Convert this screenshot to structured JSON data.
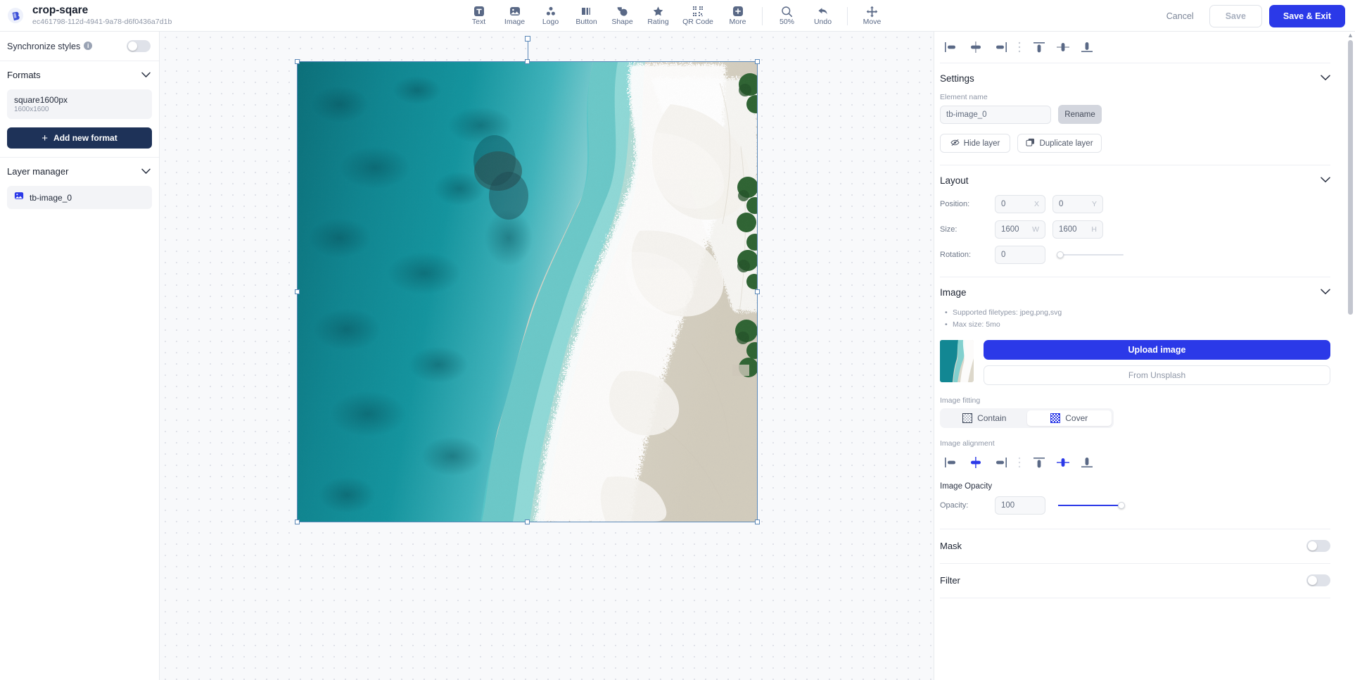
{
  "topbar": {
    "project_title": "crop-sqare",
    "project_id": "ec461798-112d-4941-9a78-d6f0436a7d1b",
    "logo_icon": "app-logo-icon",
    "tools": [
      {
        "label": "Text",
        "icon": "text-icon"
      },
      {
        "label": "Image",
        "icon": "image-icon"
      },
      {
        "label": "Logo",
        "icon": "logo-icon"
      },
      {
        "label": "Button",
        "icon": "button-icon"
      },
      {
        "label": "Shape",
        "icon": "shape-icon"
      },
      {
        "label": "Rating",
        "icon": "star-icon"
      },
      {
        "label": "QR Code",
        "icon": "qrcode-icon"
      },
      {
        "label": "More",
        "icon": "plus-circle-icon"
      }
    ],
    "view_tools": [
      {
        "label": "50%",
        "icon": "magnifier-icon"
      },
      {
        "label": "Undo",
        "icon": "undo-arrow-icon"
      },
      {
        "label": "Move",
        "icon": "move-arrows-icon"
      }
    ],
    "cancel_label": "Cancel",
    "save_label": "Save",
    "save_exit_label": "Save & Exit"
  },
  "left_panel": {
    "sync_styles_label": "Synchronize styles",
    "sync_styles_on": false,
    "formats_label": "Formats",
    "formats": [
      {
        "name": "square1600px",
        "dimensions": "1600x1600"
      }
    ],
    "add_format_label": "Add new format",
    "layer_manager_label": "Layer manager",
    "layers": [
      {
        "name": "tb-image_0",
        "icon": "image-layer-icon"
      }
    ]
  },
  "canvas": {
    "zoom_level": "50%",
    "selected_element": "tb-image_0"
  },
  "right_panel": {
    "align_buttons": [
      {
        "name": "align-left-icon"
      },
      {
        "name": "align-center-horizontal-icon"
      },
      {
        "name": "align-right-icon"
      },
      {
        "name": "align-top-icon"
      },
      {
        "name": "align-center-vertical-icon"
      },
      {
        "name": "align-bottom-icon"
      }
    ],
    "settings": {
      "title": "Settings",
      "element_name_label": "Element name",
      "element_name_value": "tb-image_0",
      "rename_label": "Rename",
      "hide_layer_label": "Hide layer",
      "duplicate_layer_label": "Duplicate layer"
    },
    "layout": {
      "title": "Layout",
      "position_label": "Position:",
      "position_x": "0",
      "position_x_suffix": "X",
      "position_y": "0",
      "position_y_suffix": "Y",
      "size_label": "Size:",
      "size_w": "1600",
      "size_w_suffix": "W",
      "size_h": "1600",
      "size_h_suffix": "H",
      "rotation_label": "Rotation:",
      "rotation_value": "0"
    },
    "image": {
      "title": "Image",
      "notes": [
        "Supported filetypes: jpeg,png,svg",
        "Max size: 5mo"
      ],
      "upload_label": "Upload image",
      "unsplash_label": "From Unsplash",
      "fitting_label": "Image fitting",
      "fit_contain_label": "Contain",
      "fit_cover_label": "Cover",
      "fit_selected": "Cover",
      "alignment_label": "Image alignment",
      "opacity_section_label": "Image Opacity",
      "opacity_label": "Opacity:",
      "opacity_value": "100"
    },
    "mask": {
      "label": "Mask",
      "enabled": false
    },
    "filter": {
      "label": "Filter",
      "enabled": false
    }
  },
  "colors": {
    "accent_blue": "#2b39e8",
    "dark_navy": "#1e3258",
    "icon_gray": "#5a6986",
    "selection_blue": "#5b88b8"
  }
}
